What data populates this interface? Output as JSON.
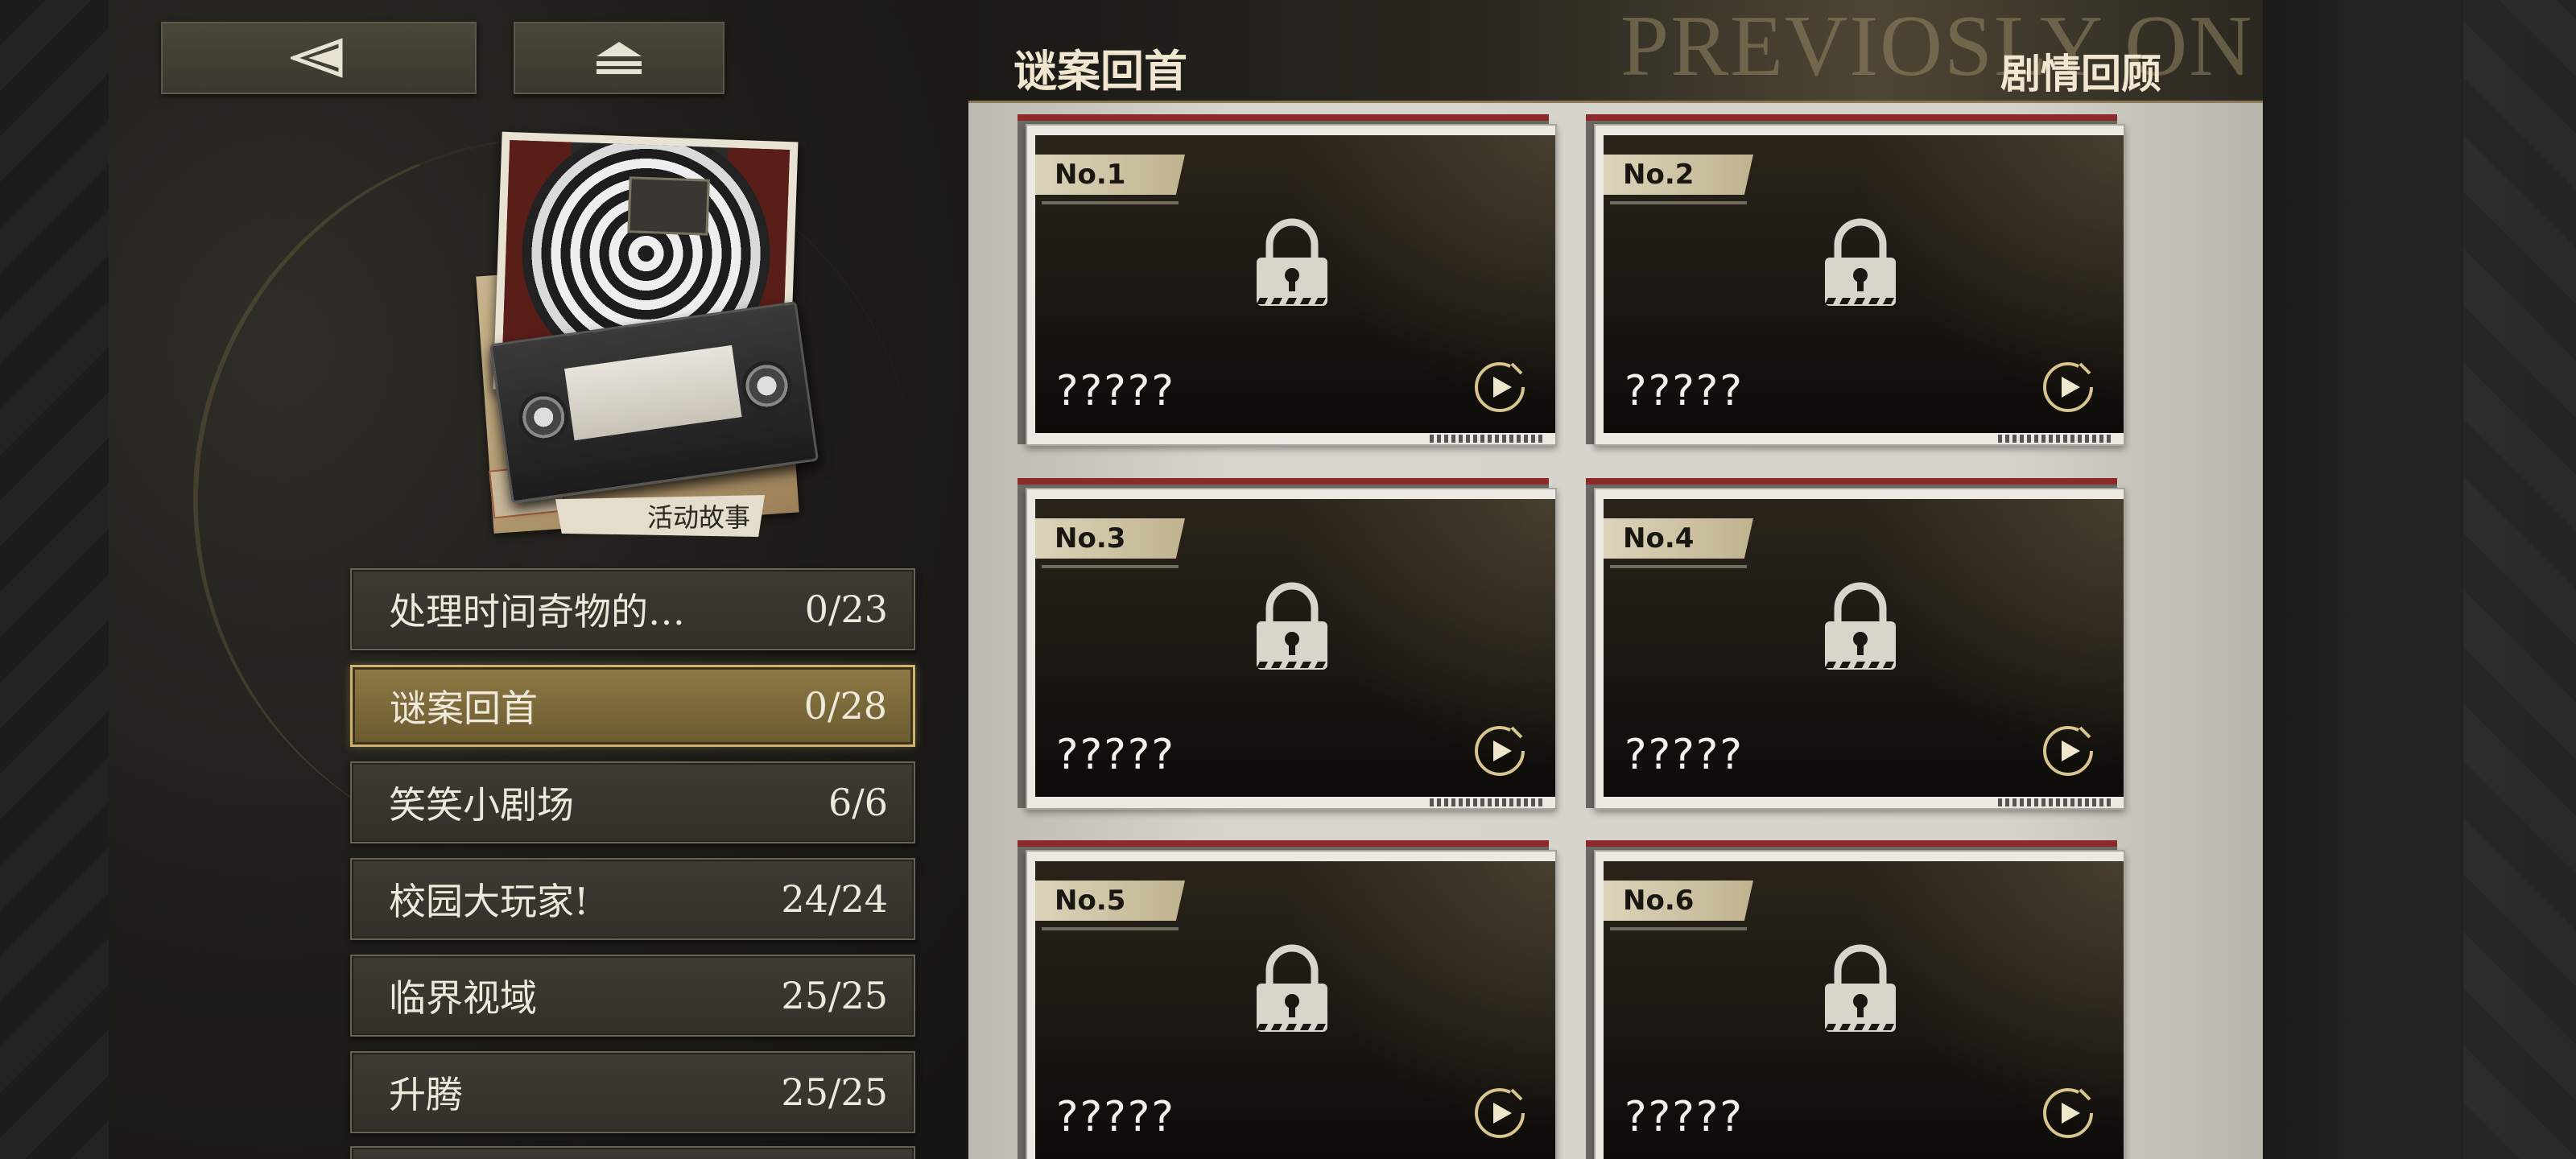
{
  "nav": {
    "back_icon": "back-triangle-icon",
    "home_icon": "eject-home-icon"
  },
  "cover": {
    "caption": "活动故事"
  },
  "list": {
    "items": [
      {
        "label": "处理时间奇物的…",
        "count": "0/23",
        "active": false
      },
      {
        "label": "谜案回首",
        "count": "0/28",
        "active": true
      },
      {
        "label": "笑笑小剧场",
        "count": "6/6",
        "active": false
      },
      {
        "label": "校园大玩家!",
        "count": "24/24",
        "active": false
      },
      {
        "label": "临界视域",
        "count": "25/25",
        "active": false
      },
      {
        "label": "升腾",
        "count": "25/25",
        "active": false
      }
    ]
  },
  "panel": {
    "title": "谜案回首",
    "subtitle": "剧情回顾",
    "watermark": "PREVIOSLY ON"
  },
  "cards": [
    {
      "no": "No.1",
      "name": "?????",
      "locked": true
    },
    {
      "no": "No.2",
      "name": "?????",
      "locked": true
    },
    {
      "no": "No.3",
      "name": "?????",
      "locked": true
    },
    {
      "no": "No.4",
      "name": "?????",
      "locked": true
    },
    {
      "no": "No.5",
      "name": "?????",
      "locked": true
    },
    {
      "no": "No.6",
      "name": "?????",
      "locked": true
    }
  ],
  "colors": {
    "accent_gold": "#cdb272",
    "card_red_strip": "#8c2a2a"
  }
}
